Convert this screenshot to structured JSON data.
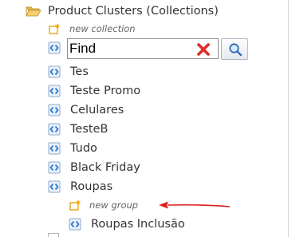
{
  "tree": {
    "root": {
      "label": "Product Clusters (Collections)",
      "icon": "folder-open-icon"
    },
    "new_collection": {
      "label": "new collection",
      "icon": "new-item-icon"
    },
    "search": {
      "value": "Find",
      "clear_icon": "clear-x-icon",
      "find_icon": "magnifier-icon"
    },
    "collections": [
      {
        "label": "Tes"
      },
      {
        "label": "Teste Promo"
      },
      {
        "label": "Celulares"
      },
      {
        "label": "TesteB"
      },
      {
        "label": "Tudo"
      },
      {
        "label": "Black Friday"
      },
      {
        "label": "Roupas"
      }
    ],
    "new_group": {
      "label": "new group",
      "icon": "new-item-icon"
    },
    "group_items": [
      {
        "label": "Roupas Inclusão"
      }
    ]
  },
  "colors": {
    "folder": "#f2c35a",
    "node_icon_blue": "#2c7ad8",
    "new_icon": "#f3b01b",
    "clear_x": "#e02b2b",
    "arrow": "#e01b1b"
  }
}
